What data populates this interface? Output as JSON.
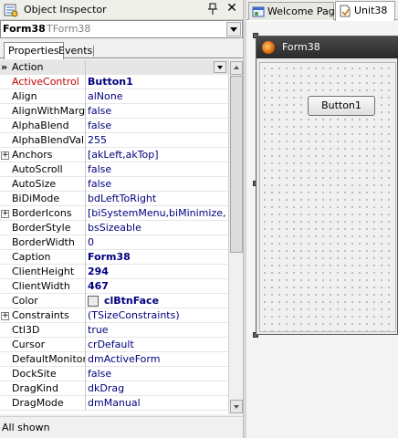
{
  "object_inspector": {
    "title": "Object Inspector",
    "selected_object": {
      "name": "Form38",
      "class": "TForm38"
    },
    "tabs": [
      {
        "label": "Properties",
        "active": true
      },
      {
        "label": "Events",
        "active": false
      }
    ],
    "properties": [
      {
        "name": "Action",
        "value": "",
        "selected": true,
        "has_dropdown": true
      },
      {
        "name": "ActiveControl",
        "value": "Button1",
        "bold": true,
        "name_red": true
      },
      {
        "name": "Align",
        "value": "alNone"
      },
      {
        "name": "AlignWithMargins",
        "value": "false"
      },
      {
        "name": "AlphaBlend",
        "value": "false"
      },
      {
        "name": "AlphaBlendValue",
        "value": "255"
      },
      {
        "name": "Anchors",
        "value": "[akLeft,akTop]",
        "expandable": true
      },
      {
        "name": "AutoScroll",
        "value": "false"
      },
      {
        "name": "AutoSize",
        "value": "false"
      },
      {
        "name": "BiDiMode",
        "value": "bdLeftToRight"
      },
      {
        "name": "BorderIcons",
        "value": "[biSystemMenu,biMinimize,biMax",
        "expandable": true
      },
      {
        "name": "BorderStyle",
        "value": "bsSizeable"
      },
      {
        "name": "BorderWidth",
        "value": "0"
      },
      {
        "name": "Caption",
        "value": "Form38",
        "bold": true
      },
      {
        "name": "ClientHeight",
        "value": "294",
        "bold": true
      },
      {
        "name": "ClientWidth",
        "value": "467",
        "bold": true
      },
      {
        "name": "Color",
        "value": "clBtnFace",
        "bold": true,
        "swatch": true
      },
      {
        "name": "Constraints",
        "value": "(TSizeConstraints)",
        "expandable": true
      },
      {
        "name": "Ctl3D",
        "value": "true"
      },
      {
        "name": "Cursor",
        "value": "crDefault"
      },
      {
        "name": "DefaultMonitor",
        "value": "dmActiveForm"
      },
      {
        "name": "DockSite",
        "value": "false"
      },
      {
        "name": "DragKind",
        "value": "dkDrag"
      },
      {
        "name": "DragMode",
        "value": "dmManual"
      }
    ],
    "status": "All shown",
    "scroll_position_fraction": 0.0
  },
  "editor": {
    "tabs": [
      {
        "label": "Welcome Page",
        "active": false,
        "icon": "welcome-page-icon"
      },
      {
        "label": "Unit38",
        "active": true,
        "icon": "unit-file-icon"
      }
    ]
  },
  "designer": {
    "form_caption": "Form38",
    "button_caption": "Button1"
  },
  "colors": {
    "property_value": "#00007f",
    "active_control_name": "#c00000",
    "form_caption_bar": "#2a2a2a"
  }
}
